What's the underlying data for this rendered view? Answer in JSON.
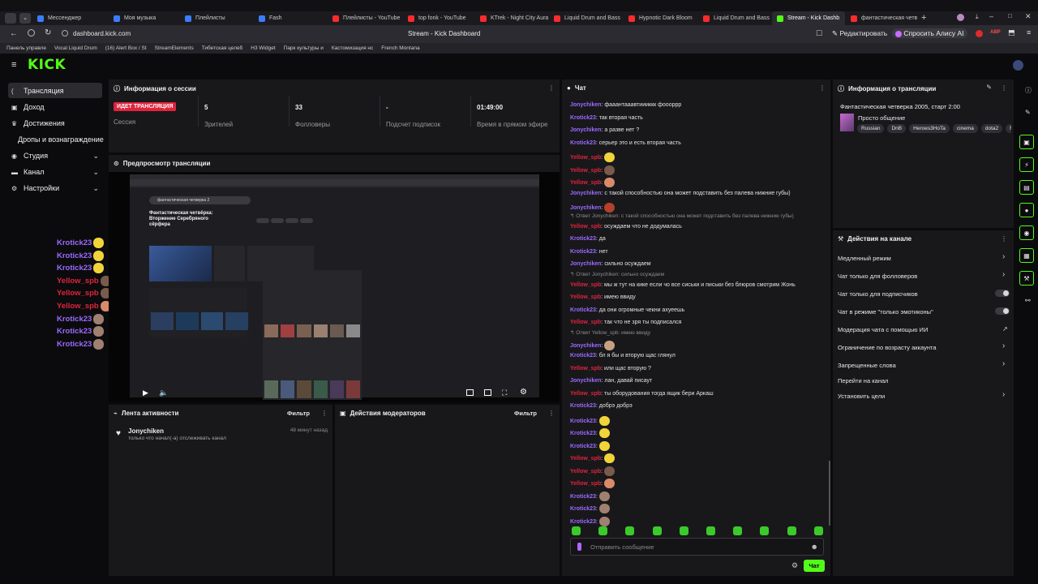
{
  "browser": {
    "tabs": [
      {
        "label": "Мессенджер",
        "color": "#3d7cff"
      },
      {
        "label": "Моя музыка",
        "color": "#3d7cff"
      },
      {
        "label": "Плейлисты",
        "color": "#3d7cff"
      },
      {
        "label": "Fash",
        "color": "#3d7cff"
      },
      {
        "label": "Плейлисты - YouTube",
        "color": "#ff2b2b"
      },
      {
        "label": "top fonk - YouTube",
        "color": "#ff2b2b"
      },
      {
        "label": "KTrek - Night City Aura",
        "color": "#ff2b2b"
      },
      {
        "label": "Liquid Drum and Bass",
        "color": "#ff2b2b"
      },
      {
        "label": "Hypnotic Dark Bloom",
        "color": "#ff2b2b"
      },
      {
        "label": "Liquid Drum and Bass",
        "color": "#ff2b2b"
      },
      {
        "label": "Stream - Kick Dashb",
        "color": "#53fc18"
      },
      {
        "label": "фантастическая четве",
        "color": "#ff2b2b"
      }
    ],
    "url": "dashboard.kick.com",
    "page_title": "Stream - Kick Dashboard",
    "edit_label": "Редактировать",
    "alice_label": "Спросить Алису AI",
    "bookmarks": [
      "Панель управле",
      "Vocal Liquid Drum",
      "(16) Alert Box / St",
      "StreamElements",
      "Тибетская целеб",
      "H3 Widget",
      "Парк культуры и",
      "Кастомизация нс",
      "French Montana"
    ]
  },
  "app": {
    "logo": "KICK",
    "accent": "#53fc18"
  },
  "sidebar": {
    "items": [
      {
        "label": "Трансляция",
        "icon": "broadcast-icon"
      },
      {
        "label": "Доход",
        "icon": "revenue-icon"
      },
      {
        "label": "Достижения",
        "icon": "trophy-icon"
      },
      {
        "label": "Дропы и вознаграждение",
        "icon": ""
      },
      {
        "label": "Студия",
        "icon": "studio-icon"
      },
      {
        "label": "Канал",
        "icon": "channel-icon"
      },
      {
        "label": "Настройки",
        "icon": "gear-icon"
      }
    ],
    "overlay_chat": [
      {
        "user": "Krotick23",
        "color": "#9b6bff"
      },
      {
        "user": "Krotick23",
        "color": "#9b6bff"
      },
      {
        "user": "Krotick23",
        "color": "#9b6bff"
      },
      {
        "user": "Yellow_spb",
        "color": "#e0243d"
      },
      {
        "user": "Yellow_spb",
        "color": "#e0243d"
      },
      {
        "user": "Yellow_spb",
        "color": "#e0243d"
      },
      {
        "user": "Krotick23",
        "color": "#9b6bff"
      },
      {
        "user": "Krotick23",
        "color": "#9b6bff"
      },
      {
        "user": "Krotick23",
        "color": "#9b6bff"
      }
    ]
  },
  "session": {
    "title": "Информация о сессии",
    "live_badge": "ИДЕТ ТРАНСЛЯЦИЯ",
    "session_label": "Сессия",
    "viewers_value": "5",
    "viewers_label": "Зрителей",
    "followers_value": "33",
    "followers_label": "Фолловеры",
    "subs_value": "-",
    "subs_label": "Подсчет подписок",
    "time_value": "01:49:00",
    "time_label": "Время в прямом эфире"
  },
  "preview": {
    "title": "Предпросмотр трансляции",
    "inner_title": "Фантастическая четвёрка: Вторжение Серебряного сёрфера",
    "inner_search": "фантастическая четверка 2"
  },
  "activity": {
    "title": "Лента активности",
    "filter": "Фильтр",
    "user": "Jonychiken",
    "text": "только что начал(-а) отслеживать канал",
    "time": "48 минут назад"
  },
  "mod": {
    "title": "Действия модераторов",
    "filter": "Фильтр"
  },
  "chat": {
    "title": "Чат",
    "placeholder": "Отправить сообщение",
    "send": "Чат",
    "messages": [
      {
        "user": "Jonychiken",
        "cls": "u1",
        "text": ": фааантааавтиииккк фоооррр"
      },
      {
        "user": "Krotick23",
        "cls": "u1",
        "text": ": так вторая часть"
      },
      {
        "user": "Jonychiken",
        "cls": "u1",
        "text": ": а разве нет ?"
      },
      {
        "user": "Krotick23",
        "cls": "u1",
        "text": ": серьер это и есть вторая часть"
      },
      {
        "user": "Yellow_spb",
        "cls": "u3",
        "text": ":",
        "emote": "#f1d43a"
      },
      {
        "user": "Yellow_spb",
        "cls": "u3",
        "text": ":",
        "emote": "#7a5a4a"
      },
      {
        "user": "Yellow_spb",
        "cls": "u3",
        "text": ":",
        "emote": "#d98a6a"
      },
      {
        "user": "Jonychiken",
        "cls": "u1",
        "text": ": с такой способностью она может подставить без палева нижние губы)"
      },
      {
        "user": "Jonychiken",
        "cls": "u1",
        "text": ":",
        "emote": "#b2402a"
      },
      {
        "reply": "Ответ Jonychiken: с такой способностью она может подставить без палева нижние губы)"
      },
      {
        "user": "Yellow_spb",
        "cls": "u3",
        "text": ": осуждаем что не додумалась"
      },
      {
        "user": "Krotick23",
        "cls": "u1",
        "text": ": да"
      },
      {
        "user": "Krotick23",
        "cls": "u1",
        "text": ": нет"
      },
      {
        "user": "Jonychiken",
        "cls": "u1",
        "text": ": сильно осуждаем"
      },
      {
        "reply": "Ответ Jonychiken: сильно осуждаем"
      },
      {
        "user": "Yellow_spb",
        "cls": "u3",
        "text": ": мы ж тут на кике если чо все сиськи и письки без блюров смотрим Жонь"
      },
      {
        "user": "Yellow_spb",
        "cls": "u3",
        "text": ": имею ввиду"
      },
      {
        "user": "Krotick23",
        "cls": "u1",
        "text": ": да они огромные чекни ахуеешь"
      },
      {
        "user": "Yellow_spb",
        "cls": "u3",
        "text": ": так что не зря ты подписался"
      },
      {
        "reply": "Ответ Yellow_spb: имею ввиду"
      },
      {
        "user": "Jonychiken",
        "cls": "u1",
        "text": ":",
        "emote": "#c7a080"
      },
      {
        "user": "Krotick23",
        "cls": "u1",
        "text": ": бл я бы и вторую щас глянул"
      },
      {
        "user": "Yellow_spb",
        "cls": "u3",
        "text": ": или щас вторую ?"
      },
      {
        "user": "Jonychiken",
        "cls": "u1",
        "text": ": лан, давай писаут"
      },
      {
        "user": "Yellow_spb",
        "cls": "u3",
        "text": ": ты оборудования тогда ящик бери Аркаш"
      },
      {
        "user": "Krotick23",
        "cls": "u1",
        "text": ": добрэ добрэ"
      },
      {
        "user": "Krotick23",
        "cls": "u1",
        "text": ":",
        "emote": "#f1d43a"
      },
      {
        "user": "Krotick23",
        "cls": "u1",
        "text": ":",
        "emote": "#f1d43a"
      },
      {
        "user": "Krotick23",
        "cls": "u1",
        "text": ":",
        "emote": "#f1d43a"
      },
      {
        "user": "Yellow_spb",
        "cls": "u3",
        "text": ":",
        "emote": "#f1d43a"
      },
      {
        "user": "Yellow_spb",
        "cls": "u3",
        "text": ":",
        "emote": "#7a5a4a"
      },
      {
        "user": "Yellow_spb",
        "cls": "u3",
        "text": ":",
        "emote": "#d98a6a"
      },
      {
        "user": "Krotick23",
        "cls": "u1",
        "text": ":",
        "emote": "#a08070"
      },
      {
        "user": "Krotick23",
        "cls": "u1",
        "text": ":",
        "emote": "#a08070"
      },
      {
        "user": "Krotick23",
        "cls": "u1",
        "text": ":",
        "emote": "#a08070"
      }
    ]
  },
  "stream_info": {
    "title": "Информация о трансляции",
    "stream_title": "Фантастическая четверка 2005, старт 2:00",
    "category": "Просто общение",
    "tags": [
      "Russian",
      "DnB",
      "Heroes3HoTa",
      "cinema",
      "dota2",
      "fon"
    ]
  },
  "channel_actions": {
    "title": "Действия на канале",
    "items": [
      {
        "label": "Медленный режим",
        "control": "chevron"
      },
      {
        "label": "Чат только для фолловеров",
        "control": "chevron"
      },
      {
        "label": "Чат только для подписчиков",
        "control": "toggle"
      },
      {
        "label": "Чат в режиме \"только эмотиконы\"",
        "control": "toggle"
      },
      {
        "label": "Модерация чата с помощью ИИ",
        "control": "external"
      },
      {
        "label": "Ограничение по возрасту аккаунта",
        "control": "chevron"
      },
      {
        "label": "Запрещенные слова",
        "control": "chevron"
      },
      {
        "label": "Перейти на канал",
        "control": "none"
      },
      {
        "label": "Установить цели",
        "control": "chevron"
      }
    ]
  }
}
